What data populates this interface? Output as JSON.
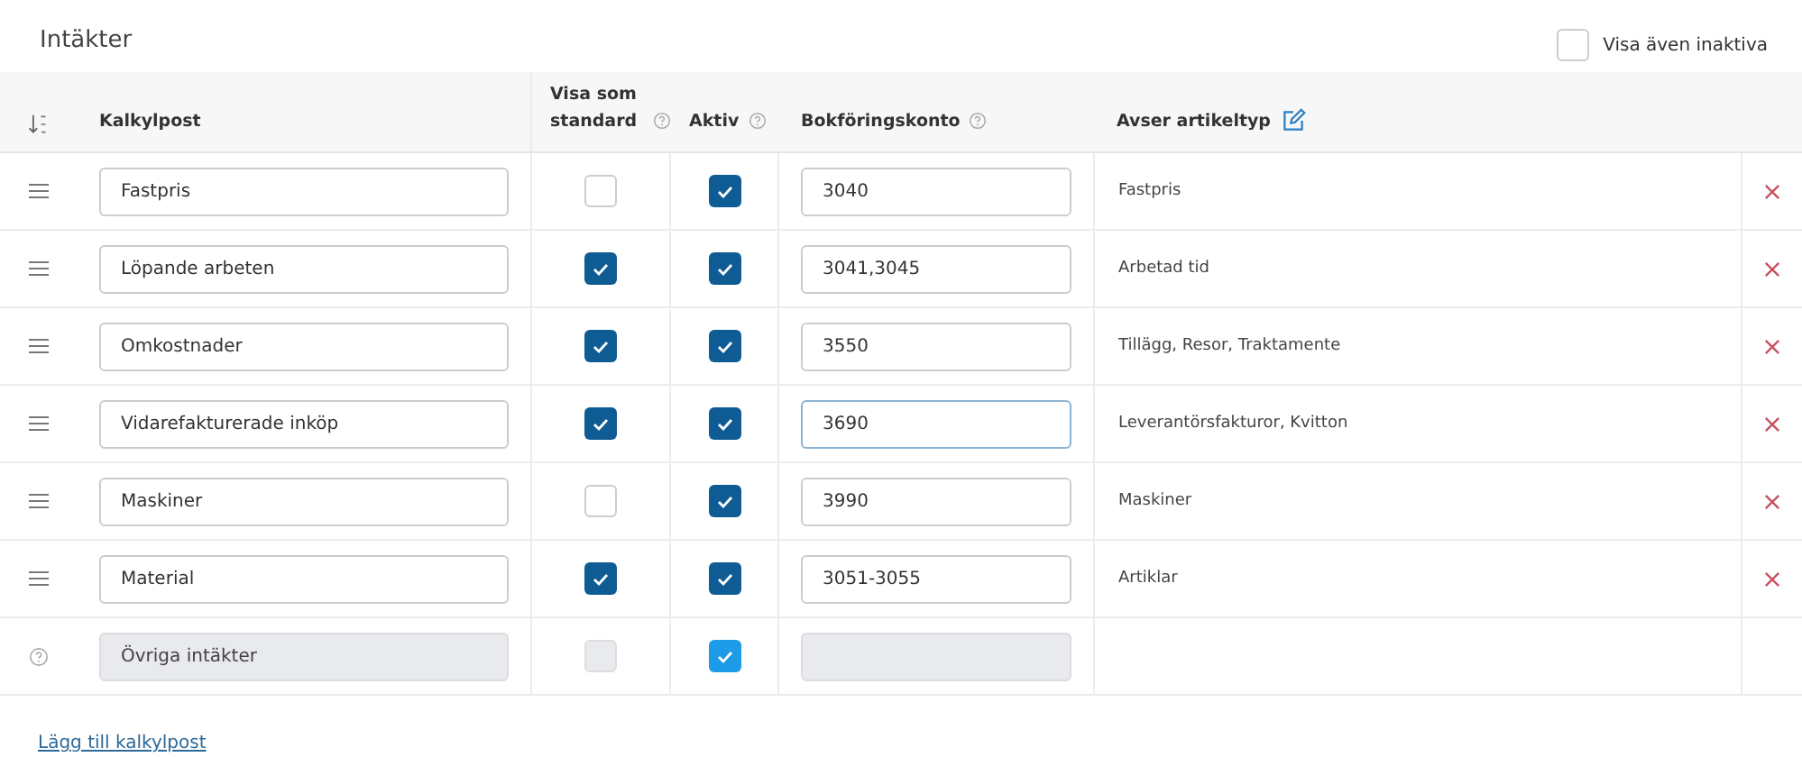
{
  "section_title": "Intäkter",
  "show_inactive": {
    "label": "Visa även inaktiva",
    "checked": false
  },
  "columns": [
    {
      "kind": "sort"
    },
    {
      "kind": "text",
      "label": "Kalkylpost"
    },
    {
      "kind": "help",
      "label": "Visa som standard"
    },
    {
      "kind": "help",
      "label": "Aktiv"
    },
    {
      "kind": "help",
      "label": "Bokföringskonto"
    },
    {
      "kind": "edit",
      "label": "Avser artikeltyp"
    },
    {
      "kind": "blank"
    }
  ],
  "rows": [
    {
      "kind": "custom",
      "name": "Fastpris",
      "standard": false,
      "active": true,
      "account": "3040",
      "focused": false,
      "article_type": "Fastpris"
    },
    {
      "kind": "custom",
      "name": "Löpande arbeten",
      "standard": true,
      "active": true,
      "account": "3041,3045",
      "focused": false,
      "article_type": "Arbetad tid"
    },
    {
      "kind": "custom",
      "name": "Omkostnader",
      "standard": true,
      "active": true,
      "account": "3550",
      "focused": false,
      "article_type": "Tillägg, Resor, Traktamente"
    },
    {
      "kind": "custom",
      "name": "Vidarefakturerade inköp",
      "standard": true,
      "active": true,
      "account": "3690",
      "focused": true,
      "article_type": "Leverantörsfakturor, Kvitton"
    },
    {
      "kind": "custom",
      "name": "Maskiner",
      "standard": false,
      "active": true,
      "account": "3990",
      "focused": false,
      "article_type": "Maskiner"
    },
    {
      "kind": "custom",
      "name": "Material",
      "standard": true,
      "active": true,
      "account": "3051-3055",
      "focused": false,
      "article_type": "Artiklar"
    },
    {
      "kind": "system",
      "name": "Övriga intäkter",
      "standard": false,
      "active": true
    }
  ],
  "add_link": "Lägg till kalkylpost"
}
